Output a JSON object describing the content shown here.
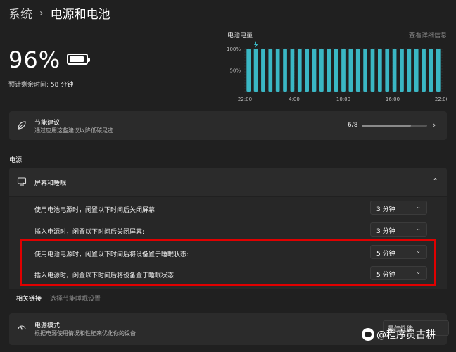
{
  "breadcrumb": {
    "parent": "系统",
    "separator": "›",
    "current": "电源和电池"
  },
  "battery": {
    "percent": "96%",
    "remaining_label": "预计剩余时间:",
    "remaining_value": "58 分钟",
    "level": 0.96
  },
  "chart_title": "电池电量",
  "chart_link": "查看详细信息",
  "chart_data": {
    "type": "bar",
    "title": "电池电量",
    "y_ticks": [
      "100%",
      "50%"
    ],
    "x_ticks": [
      "22:00",
      "4:00",
      "10:00",
      "16:00",
      "22:00"
    ],
    "ylim": [
      0,
      100
    ],
    "values": [
      100,
      100,
      100,
      100,
      100,
      100,
      100,
      100,
      100,
      100,
      100,
      100,
      100,
      100,
      100,
      100,
      100,
      100,
      100,
      100,
      100,
      100,
      100,
      100,
      100,
      100,
      100
    ],
    "grid": true,
    "bar_color": "#3ab7c4"
  },
  "energy_card": {
    "title": "节能建议",
    "subtitle": "通过应用这些建议以降低碳足迹",
    "progress_label": "6/8",
    "progress_fraction": 0.75
  },
  "power_section_label": "电源",
  "screen_sleep": {
    "title": "屏幕和睡眠",
    "rows": [
      {
        "label": "使用电池电源时，闲置以下时间后关闭屏幕:",
        "value": "3 分钟"
      },
      {
        "label": "插入电源时，闲置以下时间后关闭屏幕:",
        "value": "3 分钟"
      },
      {
        "label": "使用电池电源时，闲置以下时间后将设备置于睡眠状态:",
        "value": "5 分钟"
      },
      {
        "label": "插入电源时，闲置以下时间后将设备置于睡眠状态:",
        "value": "5 分钟"
      }
    ]
  },
  "related_links": {
    "label": "相关链接",
    "link": "选择节能睡眠设置"
  },
  "power_mode": {
    "title": "电源模式",
    "subtitle": "根据电源使用情况和性能来优化你的设备",
    "value": "最佳性能"
  },
  "watermark": "@程序员古耕",
  "colors": {
    "background": "#202020",
    "card": "#2b2b2b",
    "accent": "#3ab7c4",
    "highlight": "#e00000"
  }
}
